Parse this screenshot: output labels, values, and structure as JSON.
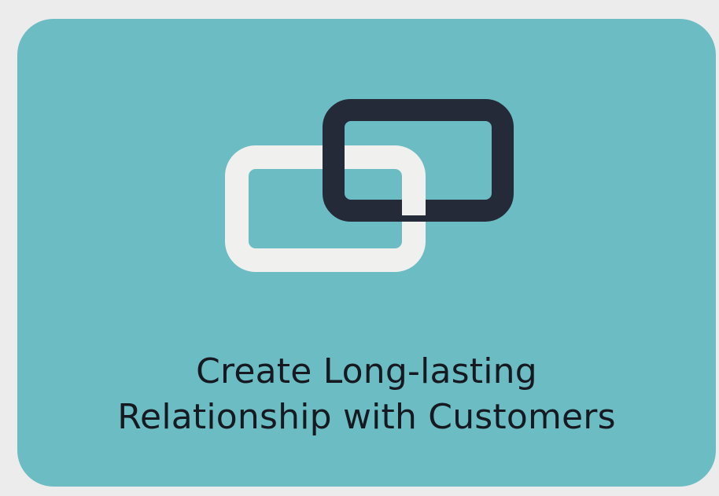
{
  "card": {
    "background_color": "#6cbcc4",
    "icon": "linked-rectangles-icon",
    "icon_colors": {
      "front_frame": "#f0f0ef",
      "back_frame": "#242a38"
    },
    "title_line_1": "Create Long-lasting",
    "title_line_2": "Relationship with Customers"
  }
}
